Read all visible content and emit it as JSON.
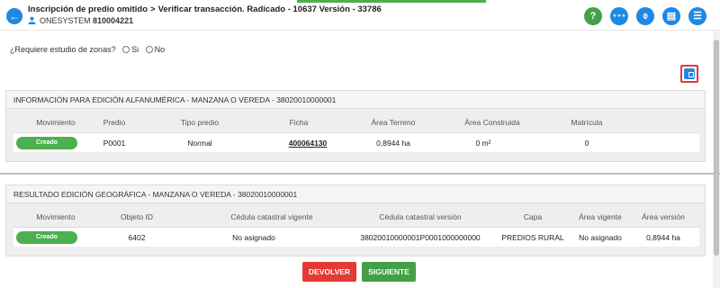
{
  "header": {
    "crumb_1": "Inscripción de predio omitido",
    "crumb_sep": ">",
    "crumb_2": "Verificar transacción. Radicado - 10637 Versión - 33786",
    "user_name": "ONESYSTEM",
    "user_code": "810004221",
    "back_glyph": "←",
    "toolbar": [
      {
        "icon": "help-icon",
        "glyph": "?"
      },
      {
        "icon": "flow-icon",
        "glyph": "∘∘∘"
      },
      {
        "icon": "attachment-icon",
        "glyph": "⌽"
      },
      {
        "icon": "document-icon",
        "glyph": "▤"
      },
      {
        "icon": "comments-icon",
        "glyph": "☰"
      }
    ]
  },
  "question": {
    "label": "¿Requiere estudio de zonas?",
    "option_yes": "Si",
    "option_no": "No"
  },
  "panel_alfa": {
    "title": "INFORMACIÓN PARA EDICIÓN ALFANUMÉRICA - MANZANA O VEREDA - 38020010000001",
    "headers": [
      "Movimiento",
      "Predio",
      "Tipo predio",
      "Ficha",
      "Área Terreno",
      "Área Construida",
      "Matrícula"
    ],
    "row": {
      "movimiento": "Creado",
      "predio": "P0001",
      "tipo_predio": "Normal",
      "ficha": "400064130",
      "area_terreno": "0,8944 ha",
      "area_construida": "0 m²",
      "matricula": "0"
    }
  },
  "panel_geo": {
    "title": "RESULTADO EDICIÓN GEOGRÁFICA - MANZANA O VEREDA - 38020010000001",
    "headers": [
      "Movimiento",
      "Objeto ID",
      "Cédula catastral vigente",
      "Cédula catastral versión",
      "Capa",
      "Área vigente",
      "Área versión"
    ],
    "row": {
      "movimiento": "Creado",
      "objeto_id": "6402",
      "cedula_vigente": "No asignado",
      "cedula_version": "38020010000001P0001000000000",
      "capa": "PREDIOS RURAL",
      "area_vigente": "No asignado",
      "area_version": "0,8944 ha"
    }
  },
  "buttons": {
    "devolver": "DEVOLVER",
    "siguiente": "SIGUIENTE"
  }
}
